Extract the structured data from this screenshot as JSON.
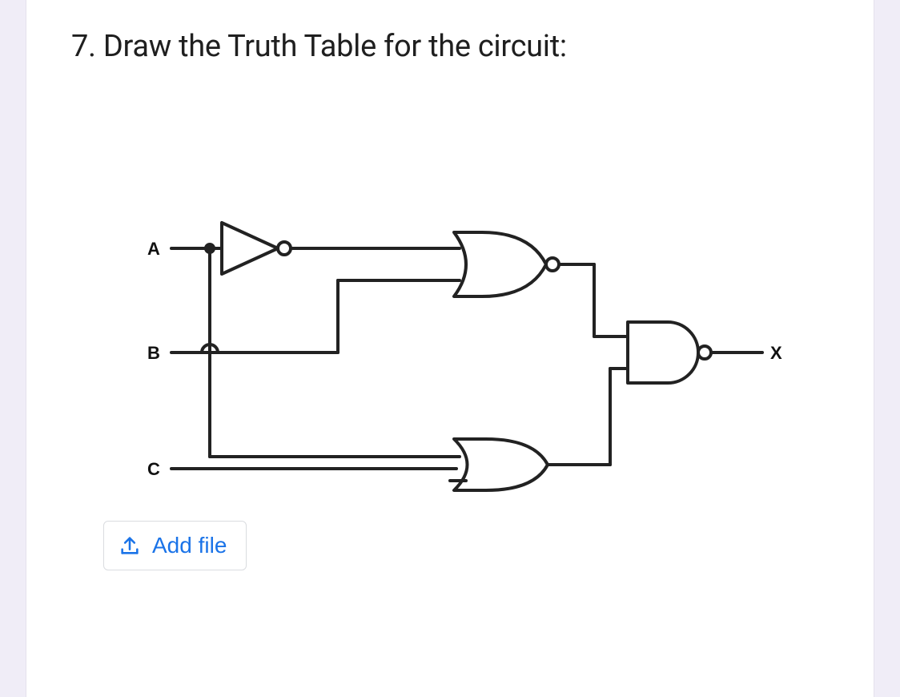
{
  "question": {
    "number": "7.",
    "prompt": "Draw the Truth Table for the circuit:"
  },
  "circuit": {
    "inputs": {
      "A": "A",
      "B": "B",
      "C": "C"
    },
    "output": "X",
    "gates": [
      {
        "id": "g1",
        "type": "NOT",
        "inputs": [
          "A"
        ],
        "output": "n1"
      },
      {
        "id": "g2",
        "type": "NOR",
        "inputs": [
          "n1",
          "B"
        ],
        "output": "n2"
      },
      {
        "id": "g3",
        "type": "OR",
        "inputs": [
          "A",
          "C"
        ],
        "output": "n3"
      },
      {
        "id": "g4",
        "type": "NAND",
        "inputs": [
          "n2",
          "n3"
        ],
        "output": "X"
      }
    ]
  },
  "controls": {
    "add_file_label": "Add file"
  },
  "colors": {
    "accent": "#1a73e8",
    "card_bg": "#ffffff",
    "page_bg": "#f0edf7",
    "text": "#202124",
    "border": "#dadce0"
  }
}
